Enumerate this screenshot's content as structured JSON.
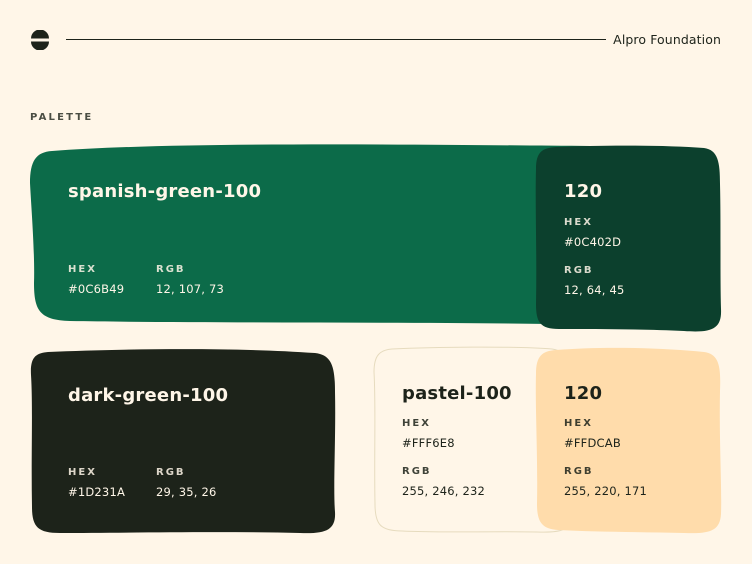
{
  "header": {
    "brand": "Alpro Foundation"
  },
  "section_title": "PALETTE",
  "labels": {
    "hex": "HEX",
    "rgb": "RGB"
  },
  "colors": {
    "spanish_green_100": {
      "name": "spanish-green-100",
      "hex": "#0C6B49",
      "rgb": "12, 107, 73",
      "color": "#0C6B49"
    },
    "spanish_green_120": {
      "name": "120",
      "hex": "#0C402D",
      "rgb": "12, 64, 45",
      "color": "#0C402D"
    },
    "dark_green_100": {
      "name": "dark-green-100",
      "hex": "#1D231A",
      "rgb": "29, 35, 26",
      "color": "#1D231A"
    },
    "pastel_100": {
      "name": "pastel-100",
      "hex": "#FFF6E8",
      "rgb": "255, 246, 232",
      "color": "#FFF6E8"
    },
    "pastel_120": {
      "name": "120",
      "hex": "#FFDCAB",
      "rgb": "255, 220, 171",
      "color": "#FFDCAB"
    }
  }
}
